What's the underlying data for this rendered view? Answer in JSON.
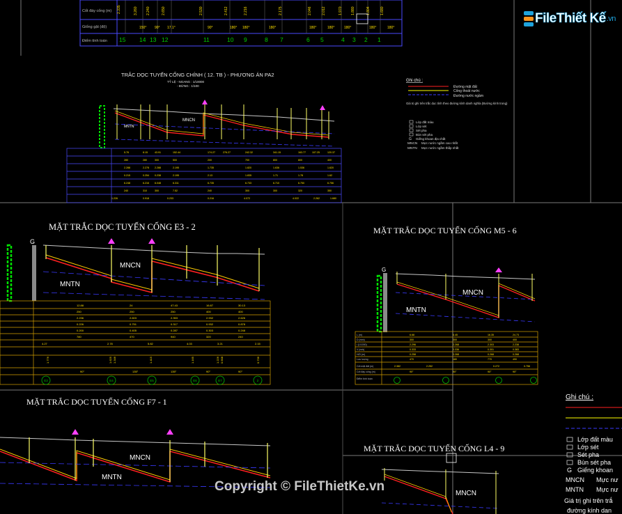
{
  "brand": {
    "logo_text": "FileThiết Kế",
    "logo_domain": ".vn",
    "watermark": "Copyright © FileThietKe.vn"
  },
  "top_table": {
    "row_labels": [
      "Cốt đáy cống (m)",
      "Giống gật (độ)",
      "Điểm tính toán"
    ],
    "point_labels": [
      "15",
      "14",
      "13",
      "12",
      "11",
      "10",
      "9",
      "8",
      "7",
      "6",
      "5",
      "4",
      "3",
      "2",
      "1"
    ]
  },
  "main_profile": {
    "title": "TRẮC DỌC TUYẾN CỐNG CHÍNH ( 12. TB ) - PHƯƠNG ÁN PA2",
    "scale_line": "TỶ LỆ - NGANG : 1/10000",
    "scale_line_2": "- ĐỨNG : 1/100",
    "tag_mncn": "MNCN",
    "tag_mntn": "MNTN"
  },
  "legend_small": {
    "title": "Ghi chú :",
    "lines": [
      "Đường mặt đất",
      "Cống thoát nước",
      "Đường nước ngầm"
    ],
    "note": "Giá trị ghi trên trắc dọc tính theo đường kính danh nghĩa (Đường kính trong)",
    "soil": [
      "Lớp đất màu",
      "Lớp sét",
      "Sét pha",
      "Bùn sét pha",
      "Giếng khoan địa chất"
    ],
    "symbols": [
      {
        "sym": "MNCN",
        "text": "Mực nước ngầm cao nhất"
      },
      {
        "sym": "MNTN",
        "text": "Mực nước ngầm thấp nhất"
      }
    ]
  },
  "profile_e3": {
    "title": "MẶT TRẮC DỌC TUYẾN CỐNG E3 - 2",
    "tag_mncn": "MNCN",
    "tag_mntn": "MNTN",
    "nodes": [
      "E3",
      "E4",
      "E5",
      "E6",
      "E7",
      "2"
    ]
  },
  "profile_m5": {
    "title": "MẶT TRẮC DỌC TUYẾN CỐNG M5 - 6",
    "tag_mncn": "MNCN",
    "tag_mntn": "MNTN"
  },
  "profile_f7": {
    "title": "MẶT TRẮC DỌC TUYẾN CỐNG F7 - 1",
    "tag_mncn": "MNCN",
    "tag_mntn": "MNTN"
  },
  "profile_l4": {
    "title": "MẶT TRẮC DỌC TUYẾN CỐNG L4 - 9",
    "tag_mncn": "MNCN"
  },
  "legend_large": {
    "title": "Ghi chú :",
    "soil": [
      "Lớp đất màu",
      "Lớp sét",
      "Sét pha",
      "Bùn sét pha",
      "Giếng khoan"
    ],
    "symbols": [
      {
        "sym": "MNCN",
        "text": "Mực nư"
      },
      {
        "sym": "MNTN",
        "text": "Mực nư"
      }
    ],
    "note": "Giá trị ghi trên trắ",
    "note_2": "đường kính dan"
  },
  "colors": {
    "ground": "#c8c8c8",
    "pipe_red": "#ff2020",
    "pipe_yellow": "#ffff00",
    "water": "#3a3aff",
    "grid": "#808080",
    "table": "#ffd400",
    "node": "#00c000",
    "manhole": "#ff40ff",
    "brand_blue": "#1fa3dc"
  }
}
